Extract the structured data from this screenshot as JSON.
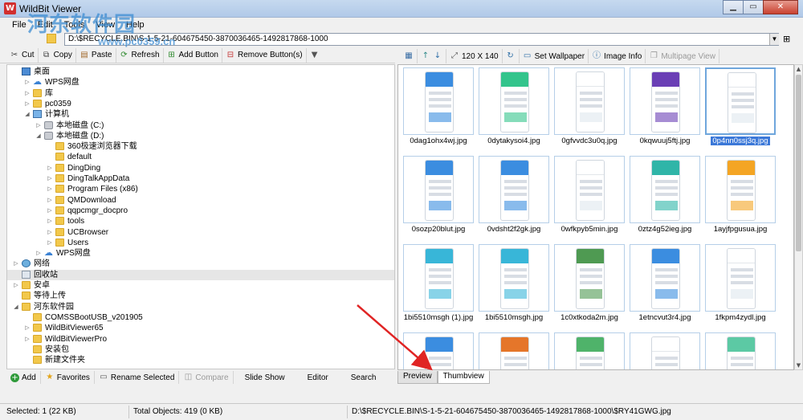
{
  "window": {
    "title": "WildBit Viewer",
    "buttons": [
      "▁",
      "▭",
      "✕"
    ]
  },
  "watermark": {
    "text": "河东软件园",
    "url": "www.pc0359.cn"
  },
  "menu": [
    "File",
    "Edit",
    "Tools",
    "View",
    "Help"
  ],
  "path": "D:\\$RECYCLE.BIN\\S-1-5-21-604675450-3870036465-1492817868-1000",
  "left_toolbar": {
    "cut": "Cut",
    "copy": "Copy",
    "paste": "Paste",
    "refresh": "Refresh",
    "add_button": "Add Button",
    "remove_button": "Remove Button(s)"
  },
  "tree": [
    {
      "label": "桌面",
      "level": 0,
      "icon": "desktop-icon",
      "toggle": ""
    },
    {
      "label": "WPS网盘",
      "level": 1,
      "icon": "cloud-icon",
      "toggle": "▷"
    },
    {
      "label": "库",
      "level": 1,
      "icon": "folder-icon",
      "toggle": "▷"
    },
    {
      "label": "pc0359",
      "level": 1,
      "icon": "user-icon",
      "toggle": "▷"
    },
    {
      "label": "计算机",
      "level": 1,
      "icon": "computer-icon",
      "toggle": "◢"
    },
    {
      "label": "本地磁盘 (C:)",
      "level": 2,
      "icon": "drive-icon",
      "toggle": "▷"
    },
    {
      "label": "本地磁盘 (D:)",
      "level": 2,
      "icon": "drive-icon",
      "toggle": "◢"
    },
    {
      "label": "360极速浏览器下载",
      "level": 3,
      "icon": "folder-icon",
      "toggle": ""
    },
    {
      "label": "default",
      "level": 3,
      "icon": "folder-icon",
      "toggle": ""
    },
    {
      "label": "DingDing",
      "level": 3,
      "icon": "folder-icon",
      "toggle": "▷"
    },
    {
      "label": "DingTalkAppData",
      "level": 3,
      "icon": "folder-icon",
      "toggle": "▷"
    },
    {
      "label": "Program Files (x86)",
      "level": 3,
      "icon": "folder-icon",
      "toggle": "▷"
    },
    {
      "label": "QMDownload",
      "level": 3,
      "icon": "folder-icon",
      "toggle": "▷"
    },
    {
      "label": "qqpcmgr_docpro",
      "level": 3,
      "icon": "folder-icon",
      "toggle": "▷"
    },
    {
      "label": "tools",
      "level": 3,
      "icon": "folder-icon",
      "toggle": "▷"
    },
    {
      "label": "UCBrowser",
      "level": 3,
      "icon": "folder-icon",
      "toggle": "▷"
    },
    {
      "label": "Users",
      "level": 3,
      "icon": "folder-icon",
      "toggle": "▷"
    },
    {
      "label": "WPS网盘",
      "level": 2,
      "icon": "cloud-icon",
      "toggle": "▷"
    },
    {
      "label": "网络",
      "level": 0,
      "icon": "network-icon",
      "toggle": "▷"
    },
    {
      "label": "回收站",
      "level": 0,
      "icon": "recycle-bin-icon",
      "toggle": "",
      "selected": true
    },
    {
      "label": "安卓",
      "level": 0,
      "icon": "folder-icon",
      "toggle": "▷"
    },
    {
      "label": "等待上传",
      "level": 0,
      "icon": "folder-icon",
      "toggle": ""
    },
    {
      "label": "河东软件园",
      "level": 0,
      "icon": "folder-icon",
      "toggle": "◢"
    },
    {
      "label": "COMSSBootUSB_v201905",
      "level": 1,
      "icon": "folder-icon",
      "toggle": ""
    },
    {
      "label": "WildBitViewer65",
      "level": 1,
      "icon": "folder-icon",
      "toggle": "▷"
    },
    {
      "label": "WildBitViewerPro",
      "level": 1,
      "icon": "folder-icon",
      "toggle": "▷"
    },
    {
      "label": "安装包",
      "level": 1,
      "icon": "folder-icon",
      "toggle": ""
    },
    {
      "label": "新建文件夹",
      "level": 1,
      "icon": "folder-icon",
      "toggle": ""
    }
  ],
  "left_bottom": {
    "add": "Add",
    "favorites": "Favorites",
    "rename": "Rename Selected",
    "compare": "Compare",
    "slideshow": "Slide Show",
    "editor": "Editor",
    "search": "Search"
  },
  "right_toolbar": {
    "size": "120 X 140",
    "set_wallpaper": "Set Wallpaper",
    "image_info": "Image Info",
    "multipage": "Multipage View"
  },
  "thumbnails": [
    {
      "name": "0dag1ohx4wj.jpg",
      "color": "#3b8de0",
      "selected": false
    },
    {
      "name": "0dytakysoi4.jpg",
      "color": "#33c48c",
      "selected": false
    },
    {
      "name": "0gfvvdc3u0q.jpg",
      "color": "#ffffff",
      "selected": false
    },
    {
      "name": "0kqwuuj5ftj.jpg",
      "color": "#6a3fb5",
      "selected": false
    },
    {
      "name": "0p4nn0ssj3q.jpg",
      "color": "#ffffff",
      "selected": true
    },
    {
      "name": "0sozp20blut.jpg",
      "color": "#3b8de0",
      "selected": false
    },
    {
      "name": "0vdsht2f2gk.jpg",
      "color": "#3b8de0",
      "selected": false
    },
    {
      "name": "0wfkpyb5min.jpg",
      "color": "#ffffff",
      "selected": false
    },
    {
      "name": "0ztz4g52ieg.jpg",
      "color": "#2fb5a8",
      "selected": false
    },
    {
      "name": "1ayjfpgusua.jpg",
      "color": "#f4a524",
      "selected": false
    },
    {
      "name": "1bi5510msgh (1).jpg",
      "color": "#38b6d8",
      "selected": false
    },
    {
      "name": "1bi5510msgh.jpg",
      "color": "#38b6d8",
      "selected": false
    },
    {
      "name": "1c0xtkoda2m.jpg",
      "color": "#4f9a52",
      "selected": false
    },
    {
      "name": "1etncvut3r4.jpg",
      "color": "#3b8de0",
      "selected": false
    },
    {
      "name": "1fkpm4zydl.jpg",
      "color": "#ffffff",
      "selected": false
    },
    {
      "name": "",
      "color": "#3b8de0",
      "selected": false
    },
    {
      "name": "",
      "color": "#e5762a",
      "selected": false
    },
    {
      "name": "",
      "color": "#4fb36a",
      "selected": false
    },
    {
      "name": "",
      "color": "#ffffff",
      "selected": false
    },
    {
      "name": "",
      "color": "#5cc9a4",
      "selected": false
    }
  ],
  "tabs": [
    "Preview",
    "Thumbview"
  ],
  "status": {
    "selected": "Selected: 1 (22 KB)",
    "total": "Total Objects: 419 (0 KB)",
    "file": "D:\\$RECYCLE.BIN\\S-1-5-21-604675450-3870036465-1492817868-1000\\$RY41GWG.jpg"
  },
  "colors": {
    "accent": "#3b78d8",
    "annotation_arrow": "#e02424"
  }
}
